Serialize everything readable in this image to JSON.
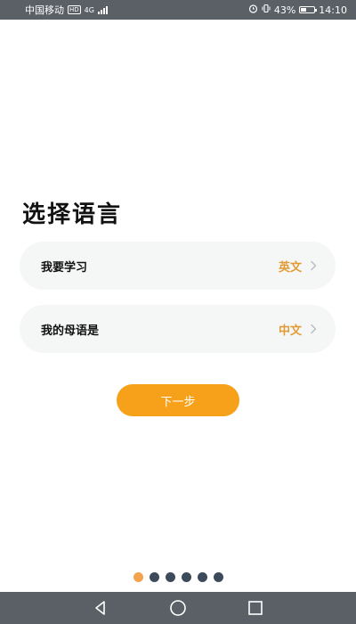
{
  "status_bar": {
    "carrier": "中国移动",
    "hd": "HD",
    "network": "4G",
    "battery": "43%",
    "battery_level": 0.43,
    "time": "14:10"
  },
  "title": "选择语言",
  "learn_card": {
    "label": "我要学习",
    "value": "英文"
  },
  "native_card": {
    "label": "我的母语是",
    "value": "中文"
  },
  "next_button": "下一步",
  "pager": {
    "count": 6,
    "active_index": 0
  },
  "colors": {
    "accent": "#f7a11a",
    "value_text": "#e29a35",
    "card_bg": "#f4f7f5",
    "dot_inactive": "#3d4a5c",
    "dot_active": "#f2a34c",
    "system_bar": "#5b6067"
  },
  "icons": {
    "chevron": "chevron-right-icon",
    "nav_back": "back-triangle-icon",
    "nav_home": "home-circle-icon",
    "nav_recent": "recent-square-icon"
  }
}
